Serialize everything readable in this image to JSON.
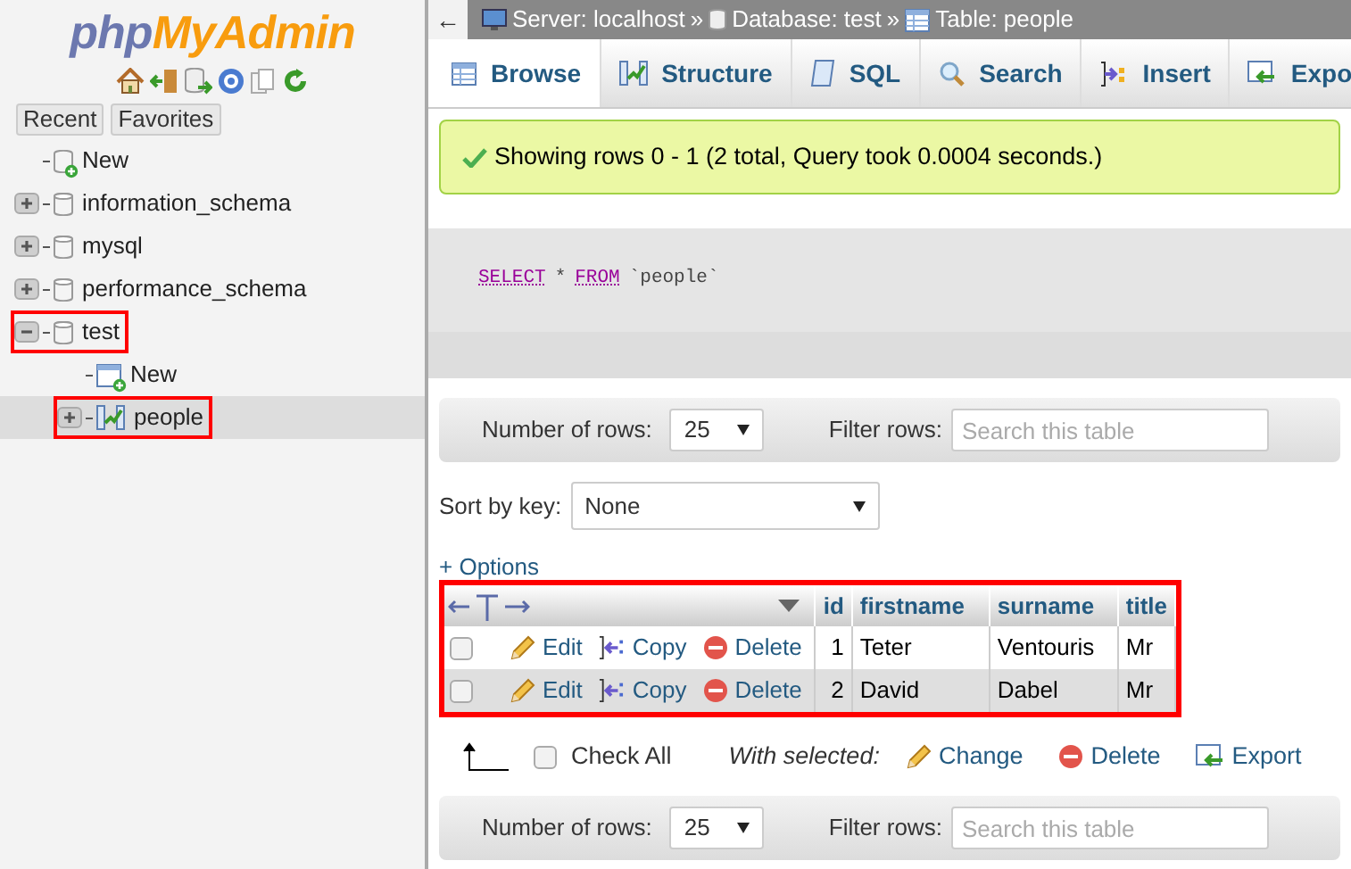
{
  "sidebar": {
    "logo": {
      "part_1": "php",
      "part_2": "MyAdmin"
    },
    "buttons": [
      {
        "label": "Recent"
      },
      {
        "label": "Favorites"
      }
    ],
    "tree": [
      {
        "label": "New",
        "kind": "new-db"
      },
      {
        "label": "information_schema",
        "kind": "db",
        "expanded": false,
        "highlighted": false
      },
      {
        "label": "mysql",
        "kind": "db",
        "expanded": false,
        "highlighted": false
      },
      {
        "label": "performance_schema",
        "kind": "db",
        "expanded": false,
        "highlighted": false
      },
      {
        "label": "test",
        "kind": "db",
        "expanded": true,
        "highlighted": true,
        "children": [
          {
            "label": "New",
            "kind": "new-table"
          },
          {
            "label": "people",
            "kind": "table",
            "expanded": false,
            "highlighted": true,
            "selected": true
          }
        ]
      }
    ]
  },
  "back": "←",
  "breadcrumb": [
    {
      "label": "Server: localhost",
      "kind": "server"
    },
    {
      "label": "Database: test",
      "kind": "database"
    },
    {
      "label": "Table: people",
      "kind": "table"
    }
  ],
  "breadcrumb_separator": "»",
  "tabs": [
    {
      "label": "Browse",
      "kind": "browse",
      "selected": true
    },
    {
      "label": "Structure",
      "kind": "structure",
      "selected": false
    },
    {
      "label": "SQL",
      "kind": "sql",
      "selected": false
    },
    {
      "label": "Search",
      "kind": "search",
      "selected": false
    },
    {
      "label": "Insert",
      "kind": "insert",
      "selected": false
    },
    {
      "label": "Expo",
      "kind": "export",
      "selected": false
    }
  ],
  "message": "Showing rows 0 - 1 (2 total, Query took 0.0004 seconds.)",
  "sql": [
    {
      "text": "SELECT",
      "kind": "keyword"
    },
    {
      "text": "*",
      "kind": "operator"
    },
    {
      "text": "FROM",
      "kind": "keyword"
    },
    {
      "text": "`people`",
      "kind": "identifier"
    }
  ],
  "nav_top": {
    "rows_label": "Number of rows:",
    "rows_value": "25",
    "filter_label": "Filter rows:",
    "filter_placeholder": "Search this table"
  },
  "sort": {
    "label": "Sort by key:",
    "value": "None"
  },
  "options_link": "+ Options",
  "table": {
    "highlighted": true,
    "columns": [
      "id",
      "firstname",
      "surname",
      "title"
    ],
    "rows": [
      {
        "checked": false,
        "actions": [
          {
            "label": "Edit",
            "kind": "edit"
          },
          {
            "label": "Copy",
            "kind": "copy"
          },
          {
            "label": "Delete",
            "kind": "delete"
          }
        ],
        "cells": [
          "1",
          "Teter",
          "Ventouris",
          "Mr"
        ]
      },
      {
        "checked": false,
        "actions": [
          {
            "label": "Edit",
            "kind": "edit"
          },
          {
            "label": "Copy",
            "kind": "copy"
          },
          {
            "label": "Delete",
            "kind": "delete"
          }
        ],
        "cells": [
          "2",
          "David",
          "Dabel",
          "Mr"
        ]
      }
    ]
  },
  "bulk": {
    "check_all": "Check All",
    "checked": false,
    "with_selected": "With selected:",
    "actions": [
      {
        "label": "Change",
        "kind": "edit"
      },
      {
        "label": "Delete",
        "kind": "delete"
      },
      {
        "label": "Export",
        "kind": "export"
      }
    ]
  },
  "nav_bottom": {
    "rows_label": "Number of rows:",
    "rows_value": "25",
    "filter_label": "Filter rows:",
    "filter_placeholder": "Search this table"
  }
}
